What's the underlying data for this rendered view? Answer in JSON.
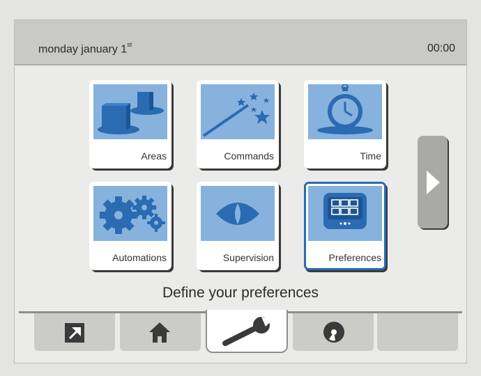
{
  "header": {
    "date_label": "monday january 1",
    "date_suffix": "st",
    "time": "00:00"
  },
  "tiles": [
    {
      "label": "Areas",
      "icon": "areas-icon",
      "selected": false
    },
    {
      "label": "Commands",
      "icon": "magic-wand-icon",
      "selected": false
    },
    {
      "label": "Time",
      "icon": "stopwatch-icon",
      "selected": false
    },
    {
      "label": "Automations",
      "icon": "gears-icon",
      "selected": false
    },
    {
      "label": "Supervision",
      "icon": "eye-icon",
      "selected": false
    },
    {
      "label": "Preferences",
      "icon": "keypad-icon",
      "selected": true
    }
  ],
  "caption": "Define your preferences",
  "next_icon": "chevron-right-icon",
  "tabs": [
    {
      "icon": "shortcut-arrow-icon",
      "active": false
    },
    {
      "icon": "home-icon",
      "active": false
    },
    {
      "icon": "wrench-icon",
      "active": true
    },
    {
      "icon": "disc-icon",
      "active": false
    },
    {
      "icon": "",
      "active": false
    }
  ],
  "colors": {
    "tile_art": "#86b2dd",
    "icon_blue": "#2a6bb2",
    "selection_border": "#2a6bb2",
    "header_bg": "#c9c9c6",
    "tab_bg": "#cbcbc8"
  }
}
